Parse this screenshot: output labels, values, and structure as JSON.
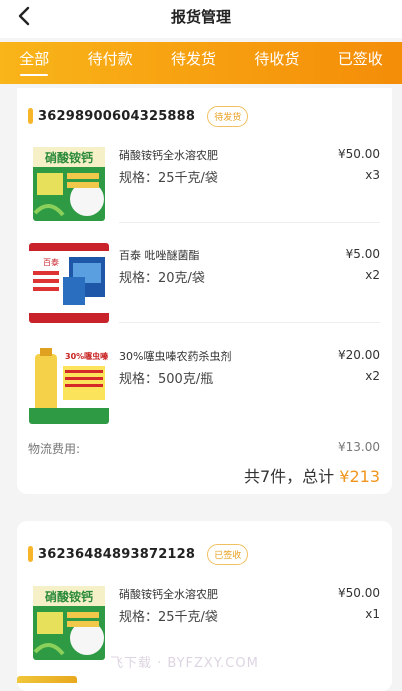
{
  "header": {
    "title": "报货管理",
    "back_icon": "chevron-left-icon"
  },
  "tabs": [
    {
      "label": "全部",
      "active": true
    },
    {
      "label": "待付款",
      "active": false
    },
    {
      "label": "待发货",
      "active": false
    },
    {
      "label": "待收货",
      "active": false
    },
    {
      "label": "已签收",
      "active": false
    }
  ],
  "colors": {
    "accent": "#f7a010",
    "price_accent": "#f0961e",
    "badge": "#e8a020"
  },
  "orders": [
    {
      "order_no": "36298900604325888",
      "status": "待发货",
      "items": [
        {
          "name": "硝酸铵钙全水溶农肥",
          "spec": "规格：25千克/袋",
          "price": "¥50.00",
          "qty": "x3",
          "image_text": "硝酸铵钙"
        },
        {
          "name": "百泰 吡唑醚菌酯",
          "spec": "规格：20克/袋",
          "price": "¥5.00",
          "qty": "x2",
          "image_text": "百泰"
        },
        {
          "name": "30%噻虫嗪农药杀虫剂",
          "spec": "规格：500克/瓶",
          "price": "¥20.00",
          "qty": "x2",
          "image_text": "30%噻虫嗪"
        }
      ],
      "shipping_label": "物流费用:",
      "shipping_fee": "¥13.00",
      "summary_prefix": "共7件，总计",
      "total_amount": "¥213"
    },
    {
      "order_no": "36236484893872128",
      "status": "已签收",
      "items": [
        {
          "name": "硝酸铵钙全水溶农肥",
          "spec": "规格：25千克/袋",
          "price": "¥50.00",
          "qty": "x1",
          "image_text": "硝酸铵钙"
        }
      ]
    }
  ],
  "watermark": "飞下载 · BYFZXY.COM"
}
